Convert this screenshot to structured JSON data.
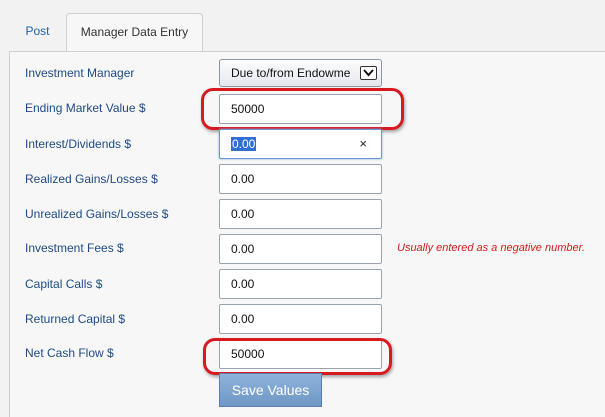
{
  "tabs": [
    {
      "label": "Post"
    },
    {
      "label": "Manager Data Entry"
    }
  ],
  "form": {
    "investment_manager": {
      "label": "Investment Manager",
      "value": "Due to/from Endowme"
    },
    "ending_market_value": {
      "label": "Ending Market Value $",
      "value": "50000"
    },
    "interest_dividends": {
      "label": "Interest/Dividends $",
      "value": "0.00",
      "clear": "×"
    },
    "realized_gains": {
      "label": "Realized Gains/Losses $",
      "value": "0.00"
    },
    "unrealized_gains": {
      "label": "Unrealized Gains/Losses $",
      "value": "0.00"
    },
    "investment_fees": {
      "label": "Investment Fees $",
      "value": "0.00",
      "hint": "Usually entered as a negative number."
    },
    "capital_calls": {
      "label": "Capital Calls $",
      "value": "0.00"
    },
    "returned_capital": {
      "label": "Returned Capital $",
      "value": "0.00"
    },
    "net_cash_flow": {
      "label": "Net Cash Flow $",
      "value": "50000"
    }
  },
  "save_button": "Save Values",
  "colors": {
    "highlight": "#d71920",
    "label": "#1f4a86",
    "hint": "#d21a1a",
    "button": "#7fa5d0"
  }
}
